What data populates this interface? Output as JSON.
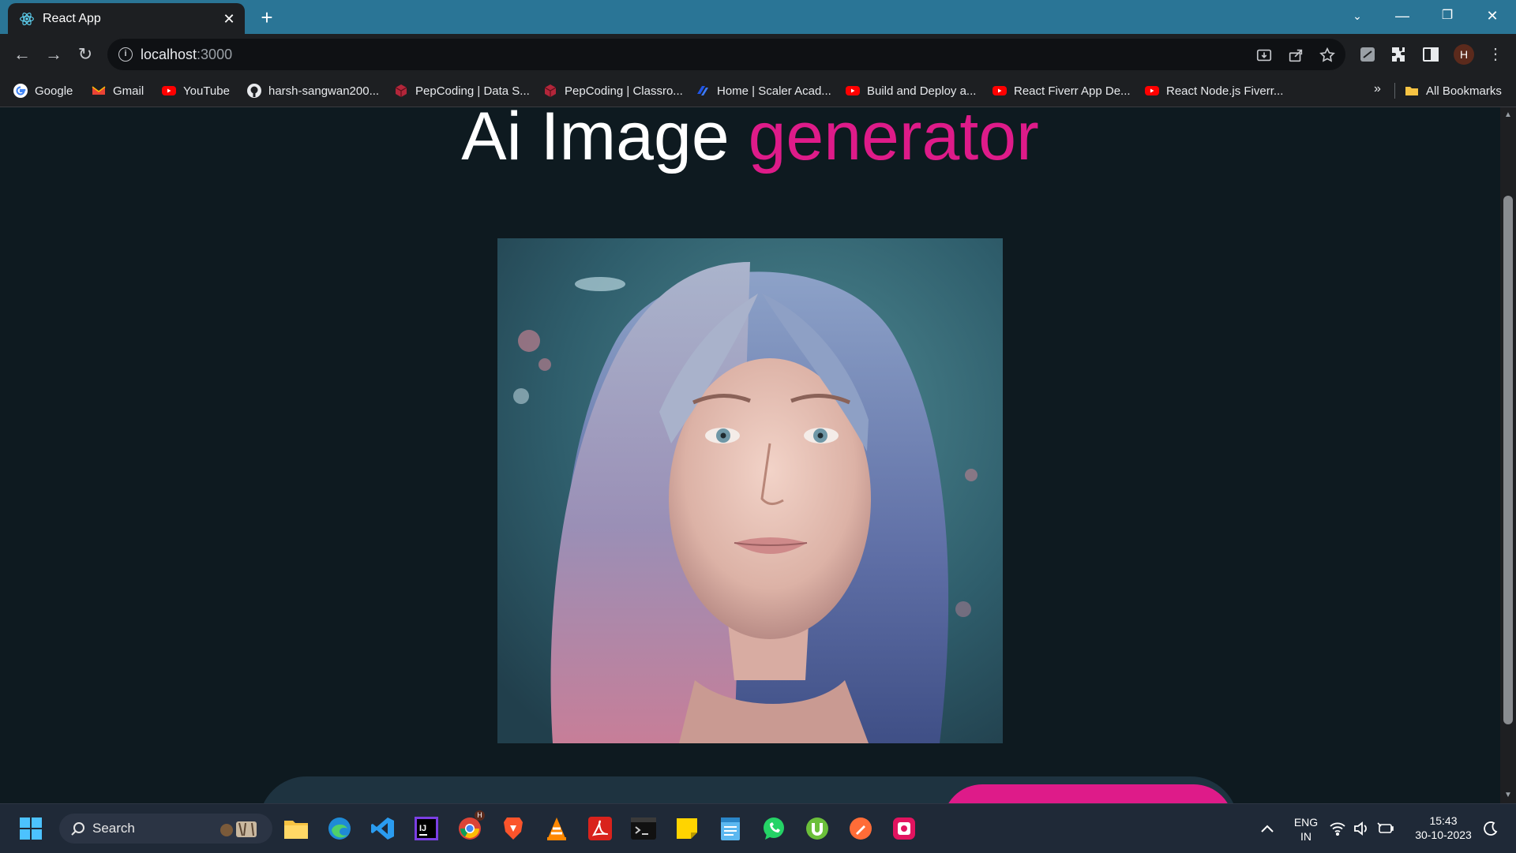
{
  "browser": {
    "tab": {
      "title": "React App"
    },
    "url": {
      "host": "localhost",
      "port": ":3000"
    },
    "profile_initial": "H",
    "bookmarks": [
      {
        "label": "Google",
        "icon": "google-icon"
      },
      {
        "label": "Gmail",
        "icon": "gmail-icon"
      },
      {
        "label": "YouTube",
        "icon": "youtube-icon"
      },
      {
        "label": "harsh-sangwan200...",
        "icon": "github-icon"
      },
      {
        "label": "PepCoding | Data S...",
        "icon": "pepcoding-icon"
      },
      {
        "label": "PepCoding | Classro...",
        "icon": "pepcoding-icon"
      },
      {
        "label": "Home | Scaler Acad...",
        "icon": "scaler-icon"
      },
      {
        "label": "Build and Deploy a...",
        "icon": "youtube-icon"
      },
      {
        "label": "React Fiverr App De...",
        "icon": "youtube-icon"
      },
      {
        "label": "React Node.js Fiverr...",
        "icon": "youtube-icon"
      }
    ],
    "bookmarks_overflow": "»",
    "all_bookmarks": "All Bookmarks"
  },
  "page": {
    "heading_main": "Ai Image",
    "heading_accent": "generator",
    "image_alt": "AI generated portrait of a woman with wavy lavender hair",
    "accent_color": "#de1b89",
    "background_color": "#0e1a20"
  },
  "taskbar": {
    "search_label": "Search",
    "language_line1": "ENG",
    "language_line2": "IN",
    "time": "15:43",
    "date": "30-10-2023",
    "chrome_badge": "H"
  }
}
